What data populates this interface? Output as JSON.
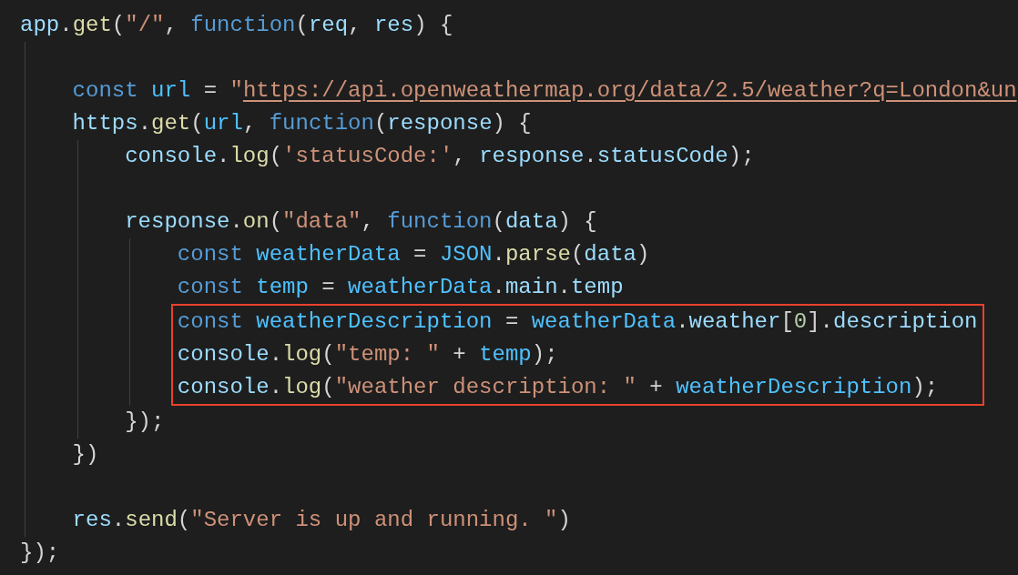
{
  "editor": {
    "lines": [
      {
        "kind": "code",
        "tokens": [
          {
            "text": "app",
            "kind": "var"
          },
          {
            "text": ".",
            "kind": "plain"
          },
          {
            "text": "get",
            "kind": "func"
          },
          {
            "text": "(",
            "kind": "plain"
          },
          {
            "text": "\"/\"",
            "kind": "string"
          },
          {
            "text": ", ",
            "kind": "plain"
          },
          {
            "text": "function",
            "kind": "keyword"
          },
          {
            "text": "(",
            "kind": "plain"
          },
          {
            "text": "req",
            "kind": "var"
          },
          {
            "text": ", ",
            "kind": "plain"
          },
          {
            "text": "res",
            "kind": "var"
          },
          {
            "text": ") {",
            "kind": "plain"
          }
        ],
        "children": [
          {
            "kind": "blank"
          },
          {
            "kind": "code",
            "tokens": [
              {
                "text": "const ",
                "kind": "keyword"
              },
              {
                "text": "url",
                "kind": "const"
              },
              {
                "text": " = ",
                "kind": "plain"
              },
              {
                "text": "\"",
                "kind": "string"
              },
              {
                "text": "https://api.openweathermap.org/data/2.5/weather?q=London&un",
                "kind": "link"
              }
            ]
          },
          {
            "kind": "code",
            "tokens": [
              {
                "text": "https",
                "kind": "var"
              },
              {
                "text": ".",
                "kind": "plain"
              },
              {
                "text": "get",
                "kind": "func"
              },
              {
                "text": "(",
                "kind": "plain"
              },
              {
                "text": "url",
                "kind": "const"
              },
              {
                "text": ", ",
                "kind": "plain"
              },
              {
                "text": "function",
                "kind": "keyword"
              },
              {
                "text": "(",
                "kind": "plain"
              },
              {
                "text": "response",
                "kind": "var"
              },
              {
                "text": ") {",
                "kind": "plain"
              }
            ],
            "children": [
              {
                "kind": "code",
                "tokens": [
                  {
                    "text": "console",
                    "kind": "var"
                  },
                  {
                    "text": ".",
                    "kind": "plain"
                  },
                  {
                    "text": "log",
                    "kind": "func"
                  },
                  {
                    "text": "(",
                    "kind": "plain"
                  },
                  {
                    "text": "'statusCode:'",
                    "kind": "string"
                  },
                  {
                    "text": ", ",
                    "kind": "plain"
                  },
                  {
                    "text": "response",
                    "kind": "var"
                  },
                  {
                    "text": ".",
                    "kind": "plain"
                  },
                  {
                    "text": "statusCode",
                    "kind": "var"
                  },
                  {
                    "text": ");",
                    "kind": "plain"
                  }
                ]
              },
              {
                "kind": "blank"
              },
              {
                "kind": "code",
                "tokens": [
                  {
                    "text": "response",
                    "kind": "var"
                  },
                  {
                    "text": ".",
                    "kind": "plain"
                  },
                  {
                    "text": "on",
                    "kind": "func"
                  },
                  {
                    "text": "(",
                    "kind": "plain"
                  },
                  {
                    "text": "\"data\"",
                    "kind": "string"
                  },
                  {
                    "text": ", ",
                    "kind": "plain"
                  },
                  {
                    "text": "function",
                    "kind": "keyword"
                  },
                  {
                    "text": "(",
                    "kind": "plain"
                  },
                  {
                    "text": "data",
                    "kind": "var"
                  },
                  {
                    "text": ") {",
                    "kind": "plain"
                  }
                ],
                "children": [
                  {
                    "kind": "code",
                    "tokens": [
                      {
                        "text": "const ",
                        "kind": "keyword"
                      },
                      {
                        "text": "weatherData",
                        "kind": "const"
                      },
                      {
                        "text": " = ",
                        "kind": "plain"
                      },
                      {
                        "text": "JSON",
                        "kind": "const"
                      },
                      {
                        "text": ".",
                        "kind": "plain"
                      },
                      {
                        "text": "parse",
                        "kind": "func"
                      },
                      {
                        "text": "(",
                        "kind": "plain"
                      },
                      {
                        "text": "data",
                        "kind": "var"
                      },
                      {
                        "text": ")",
                        "kind": "plain"
                      }
                    ]
                  },
                  {
                    "kind": "code",
                    "tokens": [
                      {
                        "text": "const ",
                        "kind": "keyword"
                      },
                      {
                        "text": "temp",
                        "kind": "const"
                      },
                      {
                        "text": " = ",
                        "kind": "plain"
                      },
                      {
                        "text": "weatherData",
                        "kind": "const"
                      },
                      {
                        "text": ".",
                        "kind": "plain"
                      },
                      {
                        "text": "main",
                        "kind": "var"
                      },
                      {
                        "text": ".",
                        "kind": "plain"
                      },
                      {
                        "text": "temp",
                        "kind": "var"
                      }
                    ]
                  },
                  {
                    "kind": "highlight",
                    "children": [
                      {
                        "kind": "code",
                        "tokens": [
                          {
                            "text": "const ",
                            "kind": "keyword"
                          },
                          {
                            "text": "weatherDescription",
                            "kind": "const"
                          },
                          {
                            "text": " = ",
                            "kind": "plain"
                          },
                          {
                            "text": "weatherData",
                            "kind": "const"
                          },
                          {
                            "text": ".",
                            "kind": "plain"
                          },
                          {
                            "text": "weather",
                            "kind": "var"
                          },
                          {
                            "text": "[",
                            "kind": "plain"
                          },
                          {
                            "text": "0",
                            "kind": "number"
                          },
                          {
                            "text": "].",
                            "kind": "plain"
                          },
                          {
                            "text": "description",
                            "kind": "var"
                          }
                        ]
                      },
                      {
                        "kind": "code",
                        "tokens": [
                          {
                            "text": "console",
                            "kind": "var"
                          },
                          {
                            "text": ".",
                            "kind": "plain"
                          },
                          {
                            "text": "log",
                            "kind": "func"
                          },
                          {
                            "text": "(",
                            "kind": "plain"
                          },
                          {
                            "text": "\"temp: \"",
                            "kind": "string"
                          },
                          {
                            "text": " + ",
                            "kind": "plain"
                          },
                          {
                            "text": "temp",
                            "kind": "const"
                          },
                          {
                            "text": ");",
                            "kind": "plain"
                          }
                        ]
                      },
                      {
                        "kind": "code",
                        "tokens": [
                          {
                            "text": "console",
                            "kind": "var"
                          },
                          {
                            "text": ".",
                            "kind": "plain"
                          },
                          {
                            "text": "log",
                            "kind": "func"
                          },
                          {
                            "text": "(",
                            "kind": "plain"
                          },
                          {
                            "text": "\"weather description: \"",
                            "kind": "string"
                          },
                          {
                            "text": " + ",
                            "kind": "plain"
                          },
                          {
                            "text": "weatherDescription",
                            "kind": "const"
                          },
                          {
                            "text": ");",
                            "kind": "plain"
                          }
                        ]
                      }
                    ]
                  }
                ]
              },
              {
                "kind": "code",
                "tokens": [
                  {
                    "text": "});",
                    "kind": "plain"
                  }
                ]
              }
            ]
          },
          {
            "kind": "code",
            "tokens": [
              {
                "text": "})",
                "kind": "plain"
              }
            ]
          },
          {
            "kind": "blank"
          },
          {
            "kind": "code",
            "tokens": [
              {
                "text": "res",
                "kind": "var"
              },
              {
                "text": ".",
                "kind": "plain"
              },
              {
                "text": "send",
                "kind": "func"
              },
              {
                "text": "(",
                "kind": "plain"
              },
              {
                "text": "\"Server is up and running. \"",
                "kind": "string"
              },
              {
                "text": ")",
                "kind": "plain"
              }
            ]
          }
        ]
      },
      {
        "kind": "code",
        "tokens": [
          {
            "text": "});",
            "kind": "plain"
          }
        ]
      }
    ]
  }
}
